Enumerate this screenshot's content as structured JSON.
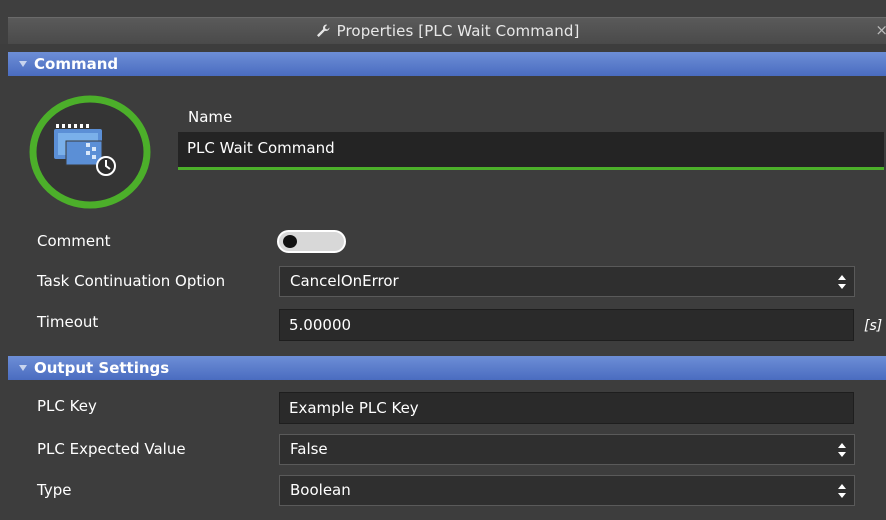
{
  "window": {
    "title": "Properties [PLC Wait Command]",
    "close_glyph": "×",
    "wrench_icon": "wrench-icon"
  },
  "sections": {
    "command": {
      "label": "Command"
    },
    "output": {
      "label": "Output Settings"
    }
  },
  "command": {
    "name_label": "Name",
    "name_value": "PLC Wait Command",
    "comment_label": "Comment",
    "comment_enabled": false,
    "task_label": "Task Continuation Option",
    "task_value": "CancelOnError",
    "timeout_label": "Timeout",
    "timeout_value": "5.00000",
    "timeout_unit": "[s]",
    "icon": "plc-command-icon",
    "accent_color": "#4caf2a"
  },
  "output": {
    "key_label": "PLC Key",
    "key_value": "Example PLC Key",
    "expected_label": "PLC Expected Value",
    "expected_value": "False",
    "type_label": "Type",
    "type_value": "Boolean"
  },
  "colors": {
    "section_header": "#5a7bcb",
    "background": "#3d3d3d",
    "field_bg": "#2a2a2a"
  }
}
